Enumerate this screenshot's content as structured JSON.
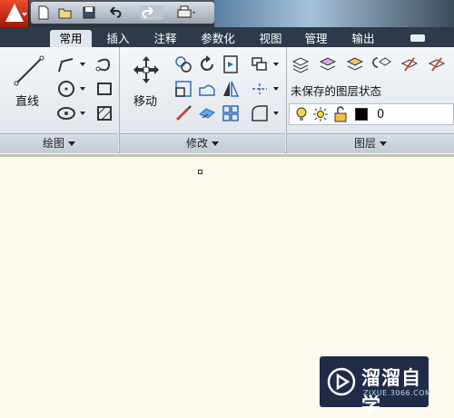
{
  "app": {
    "logo_icon": "autocad-logo-icon"
  },
  "quick_access": {
    "buttons": [
      "new-file-icon",
      "open-folder-icon",
      "save-icon",
      "undo-icon",
      "redo-icon",
      "print-icon"
    ]
  },
  "tabs": [
    {
      "label": "常用",
      "active": true
    },
    {
      "label": "插入",
      "active": false
    },
    {
      "label": "注释",
      "active": false
    },
    {
      "label": "参数化",
      "active": false
    },
    {
      "label": "视图",
      "active": false
    },
    {
      "label": "管理",
      "active": false
    },
    {
      "label": "输出",
      "active": false
    }
  ],
  "panels": {
    "draw": {
      "title": "绘图",
      "big_button": "直线"
    },
    "modify": {
      "title": "修改",
      "big_button": "移动"
    },
    "layers": {
      "title": "图层",
      "layer_state": "未保存的图层状态",
      "current_layer": "0",
      "layer_color": "#000000"
    }
  },
  "watermark": {
    "title": "溜溜自学",
    "url": "ZIXUE.3066.COM"
  }
}
